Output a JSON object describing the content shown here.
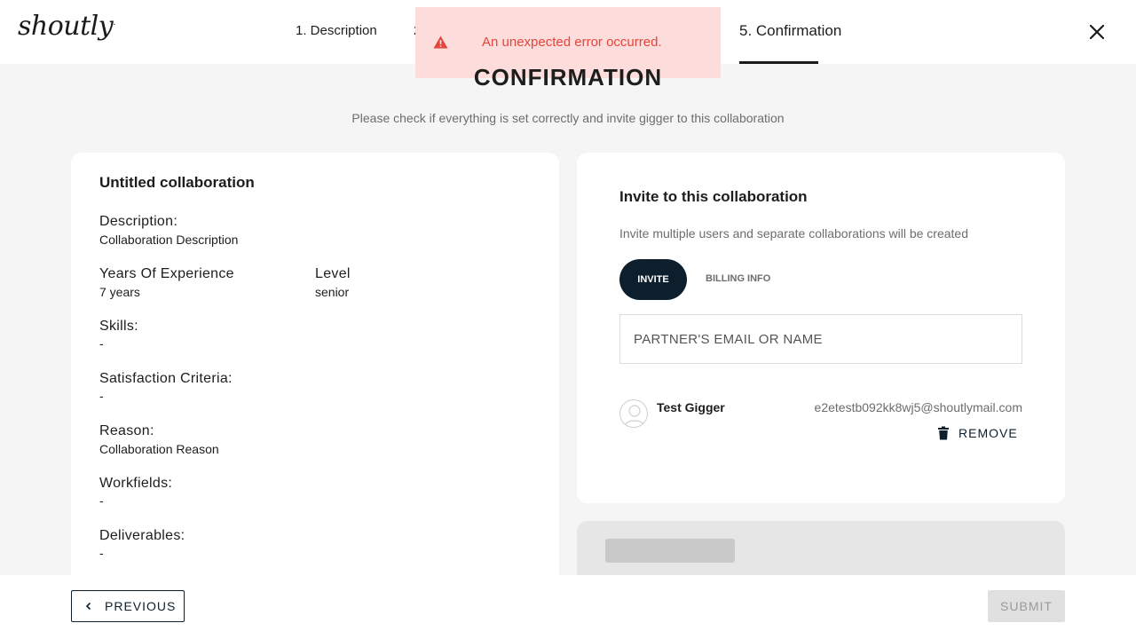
{
  "header": {
    "logo_text": "shoutly",
    "steps": {
      "step1": "1. Description",
      "step2": "2",
      "step5": "5. Confirmation"
    },
    "active_step": "5. Confirmation"
  },
  "toast": {
    "message": "An unexpected error occurred.",
    "icon": "warning-icon",
    "color": "#e4453a",
    "background": "#fddcdc"
  },
  "page": {
    "title": "CONFIRMATION",
    "subtitle": "Please check if everything is set correctly and invite gigger to this collaboration"
  },
  "collaboration": {
    "title": "Untitled collaboration",
    "description_label": "Description:",
    "description_value": "Collaboration Description",
    "experience_label": "Years Of Experience",
    "experience_value": "7 years",
    "level_label": "Level",
    "level_value": "senior",
    "skills_label": "Skills:",
    "skills_value": "-",
    "criteria_label": "Satisfaction Criteria:",
    "criteria_value": "-",
    "reason_label": "Reason:",
    "reason_value": "Collaboration Reason",
    "workfields_label": "Workfields:",
    "workfields_value": "-",
    "deliverables_label": "Deliverables:",
    "deliverables_value": "-"
  },
  "invite": {
    "title": "Invite to this collaboration",
    "subtitle": "Invite multiple users and separate collaborations will be created",
    "tabs": {
      "invite": "INVITE",
      "billing": "BILLING INFO"
    },
    "input_placeholder": "PARTNER'S EMAIL OR NAME",
    "input_value": "",
    "invitee": {
      "name": "Test Gigger",
      "email": "e2etestb092kk8wj5@shoutlymail.com",
      "remove_label": "REMOVE"
    }
  },
  "footer": {
    "previous_label": "PREVIOUS",
    "submit_label": "SUBMIT"
  },
  "colors": {
    "primary_dark": "#0d1f2d",
    "background": "#f5f5f5",
    "card": "#ffffff"
  }
}
